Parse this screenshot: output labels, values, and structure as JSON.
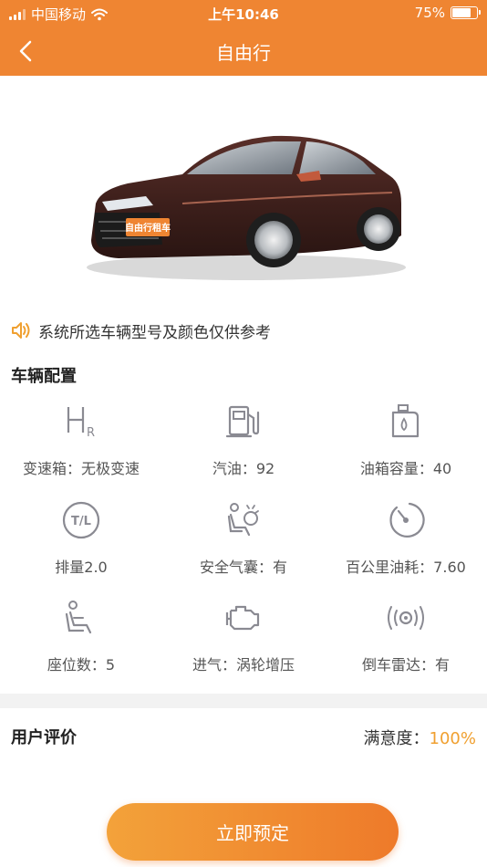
{
  "status_bar": {
    "carrier": "中国移动",
    "time": "上午10:46",
    "battery": "75%",
    "battery_level": 0.75
  },
  "nav": {
    "title": "自由行",
    "back_icon": "chevron-left-icon"
  },
  "car": {
    "plate_text": "自由行租车",
    "body_color": "#3d1f1b"
  },
  "notice": {
    "icon": "speaker-icon",
    "text": "系统所选车辆型号及颜色仅供参考"
  },
  "config": {
    "title": "车辆配置",
    "items": [
      {
        "icon": "gearbox-icon",
        "label": "变速箱：无极变速"
      },
      {
        "icon": "fuel-pump-icon",
        "label": "汽油：92"
      },
      {
        "icon": "oil-can-icon",
        "label": "油箱容量：40"
      },
      {
        "icon": "displacement-icon",
        "label": "排量2.0"
      },
      {
        "icon": "airbag-icon",
        "label": "安全气囊：有"
      },
      {
        "icon": "gauge-icon",
        "label": "百公里油耗：7.60"
      },
      {
        "icon": "seat-icon",
        "label": "座位数：5"
      },
      {
        "icon": "engine-icon",
        "label": "进气：涡轮增压"
      },
      {
        "icon": "radar-icon",
        "label": "倒车雷达：有"
      }
    ]
  },
  "reviews": {
    "title": "用户评价",
    "satisfaction_label": "满意度：",
    "satisfaction_value": "100%"
  },
  "action": {
    "book_label": "立即预定"
  },
  "colors": {
    "brand": "#ef8532",
    "accent": "#f0a030",
    "icon_gray": "#8a8a92"
  }
}
